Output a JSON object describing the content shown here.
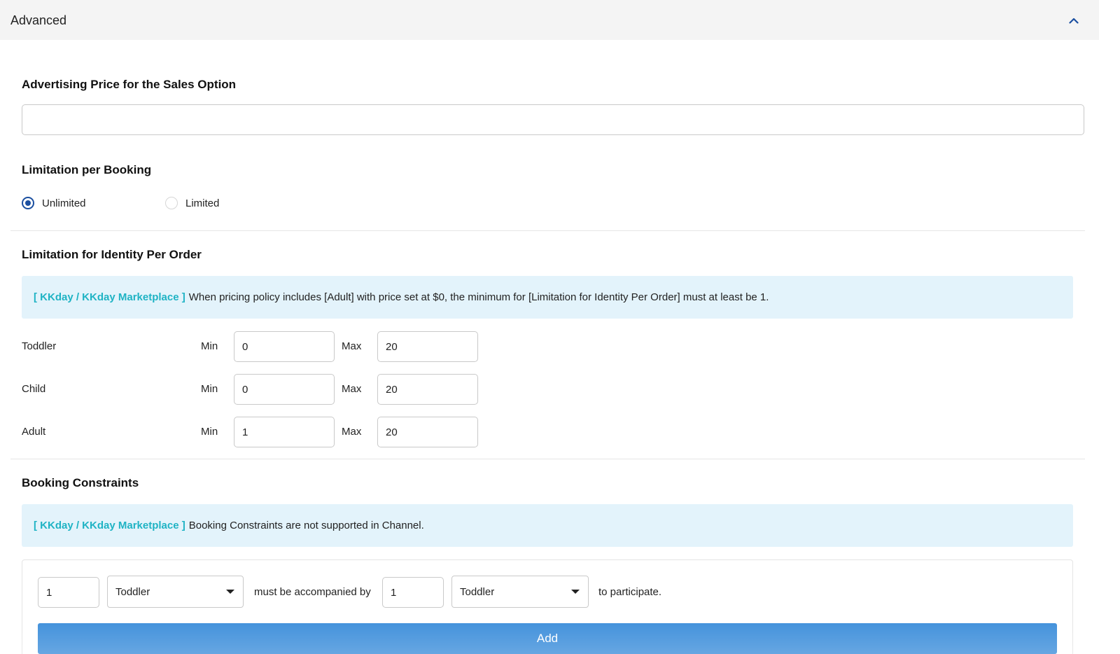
{
  "header": {
    "title": "Advanced",
    "collapse_icon": "chevron-up-icon"
  },
  "advertising_price": {
    "title": "Advertising Price for the Sales Option",
    "value": "",
    "placeholder": ""
  },
  "limitation_per_booking": {
    "title": "Limitation per Booking",
    "options": [
      {
        "label": "Unlimited",
        "checked": true
      },
      {
        "label": "Limited",
        "checked": false
      }
    ]
  },
  "identity_limits": {
    "title": "Limitation for Identity Per Order",
    "notice_tag": "[ KKday / KKday Marketplace ]",
    "notice_text": "When pricing policy includes [Adult] with price set at $0, the minimum for [Limitation for Identity Per Order] must at least be 1.",
    "min_label": "Min",
    "max_label": "Max",
    "rows": [
      {
        "label": "Toddler",
        "min": "0",
        "max": "20"
      },
      {
        "label": "Child",
        "min": "0",
        "max": "20"
      },
      {
        "label": "Adult",
        "min": "1",
        "max": "20"
      }
    ]
  },
  "booking_constraints": {
    "title": "Booking Constraints",
    "notice_tag": "[ KKday / KKday Marketplace ]",
    "notice_text": "Booking Constraints are not supported in Channel.",
    "rule": {
      "count_a": "1",
      "identity_a": "Toddler",
      "connector": "must be accompanied by",
      "count_b": "1",
      "identity_b": "Toddler",
      "suffix": "to participate."
    },
    "add_label": "Add"
  },
  "colors": {
    "accent": "#1b4fa0",
    "notice_bg": "#e3f3fb",
    "notice_tag": "#1fb3c4",
    "button": "#4593dc"
  }
}
